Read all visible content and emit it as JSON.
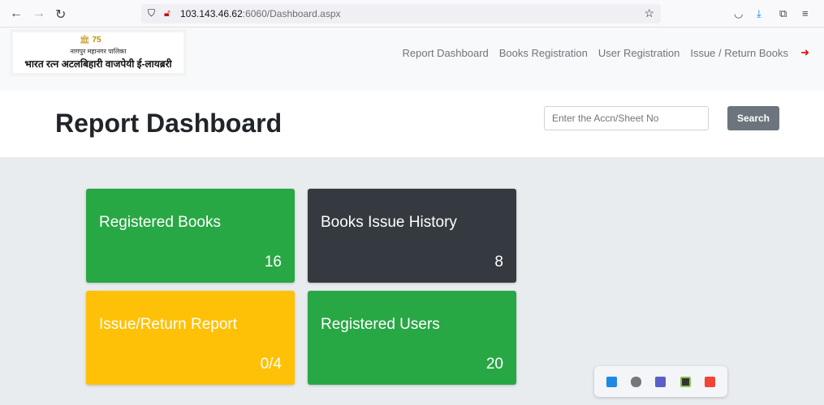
{
  "browser": {
    "url_host": "103.143.46.62",
    "url_rest": ":6060/Dashboard.aspx"
  },
  "logo": {
    "emblem": "75",
    "line1": "नागपुर महानगर पालिका",
    "line2": "भारत रत्न अटलबिहारी वाजपेयी ई-लायब्ररी"
  },
  "nav": [
    "Report Dashboard",
    "Books Registration",
    "User Registration",
    "Issue / Return Books"
  ],
  "header": {
    "title": "Report Dashboard",
    "search_placeholder": "Enter the Accn/Sheet No",
    "search_label": "Search"
  },
  "cards": [
    {
      "title": "Registered Books",
      "value": "16",
      "color": "#28a745"
    },
    {
      "title": "Books Issue History",
      "value": "8",
      "color": "#343a40"
    },
    {
      "title": "Issue/Return Report",
      "value": "0/4",
      "color": "#ffc107"
    },
    {
      "title": "Registered Users",
      "value": "20",
      "color": "#28a745"
    }
  ]
}
